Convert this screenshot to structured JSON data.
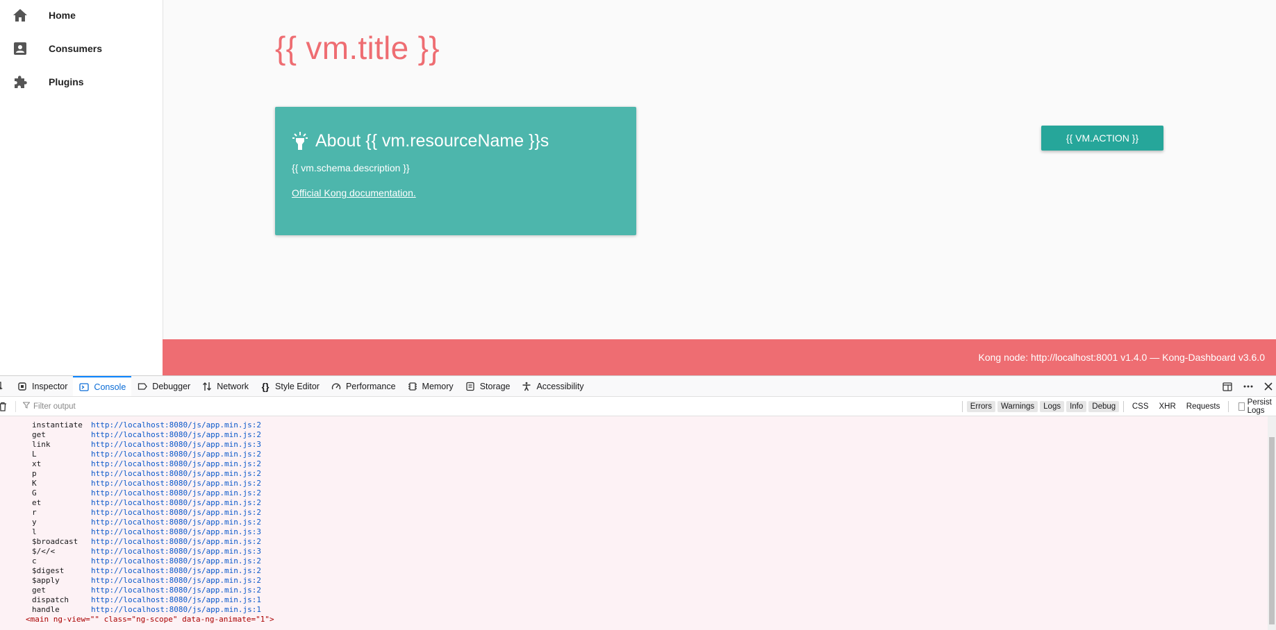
{
  "sidebar": {
    "items": [
      {
        "label": "Home",
        "icon": "home-icon"
      },
      {
        "label": "Consumers",
        "icon": "contact-card-icon"
      },
      {
        "label": "Plugins",
        "icon": "puzzle-icon"
      }
    ]
  },
  "main": {
    "title": "{{ vm.title }}",
    "card": {
      "title": "About {{ vm.resourceName }}s",
      "description": "{{ vm.schema.description }}",
      "link": "Official Kong documentation."
    },
    "action_button": "{{ VM.ACTION }}"
  },
  "footer": {
    "text": "Kong node: http://localhost:8001 v1.4.0 — Kong-Dashboard v3.6.0"
  },
  "devtools": {
    "tabs": [
      "Inspector",
      "Console",
      "Debugger",
      "Network",
      "Style Editor",
      "Performance",
      "Memory",
      "Storage",
      "Accessibility"
    ],
    "active_tab": "Console",
    "filter_placeholder": "Filter output",
    "filter_buttons": [
      "Errors",
      "Warnings",
      "Logs",
      "Info",
      "Debug"
    ],
    "type_buttons": [
      "CSS",
      "XHR",
      "Requests"
    ],
    "persist_label": "Persist Logs",
    "stack": [
      {
        "fn": "instantiate",
        "url": "http://localhost:8080/js/app.min.js:2"
      },
      {
        "fn": "get",
        "url": "http://localhost:8080/js/app.min.js:2"
      },
      {
        "fn": "link",
        "url": "http://localhost:8080/js/app.min.js:3"
      },
      {
        "fn": "L",
        "url": "http://localhost:8080/js/app.min.js:2"
      },
      {
        "fn": "xt",
        "url": "http://localhost:8080/js/app.min.js:2"
      },
      {
        "fn": "p",
        "url": "http://localhost:8080/js/app.min.js:2"
      },
      {
        "fn": "K",
        "url": "http://localhost:8080/js/app.min.js:2"
      },
      {
        "fn": "G",
        "url": "http://localhost:8080/js/app.min.js:2"
      },
      {
        "fn": "et",
        "url": "http://localhost:8080/js/app.min.js:2"
      },
      {
        "fn": "r",
        "url": "http://localhost:8080/js/app.min.js:2"
      },
      {
        "fn": "y",
        "url": "http://localhost:8080/js/app.min.js:2"
      },
      {
        "fn": "l",
        "url": "http://localhost:8080/js/app.min.js:3"
      },
      {
        "fn": "$broadcast",
        "url": "http://localhost:8080/js/app.min.js:2"
      },
      {
        "fn": "$/</<",
        "url": "http://localhost:8080/js/app.min.js:3"
      },
      {
        "fn": "c",
        "url": "http://localhost:8080/js/app.min.js:2"
      },
      {
        "fn": "$digest",
        "url": "http://localhost:8080/js/app.min.js:2"
      },
      {
        "fn": "$apply",
        "url": "http://localhost:8080/js/app.min.js:2"
      },
      {
        "fn": "get",
        "url": "http://localhost:8080/js/app.min.js:2"
      },
      {
        "fn": "dispatch",
        "url": "http://localhost:8080/js/app.min.js:1"
      },
      {
        "fn": "handle",
        "url": "http://localhost:8080/js/app.min.js:1"
      }
    ],
    "markup_line": "<main ng-view=\"\" class=\"ng-scope\" data-ng-animate=\"1\">"
  }
}
